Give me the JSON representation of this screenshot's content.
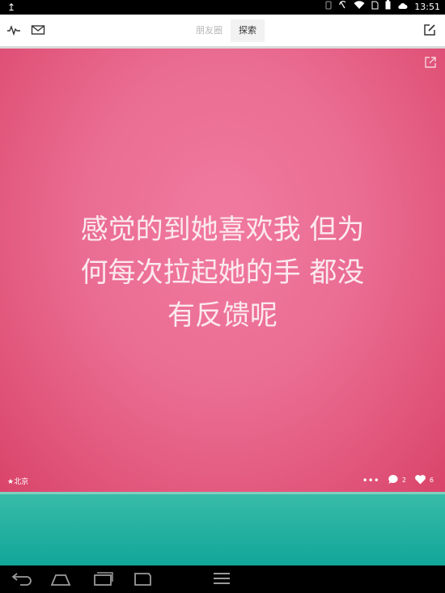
{
  "status_bar": {
    "time": "13:51"
  },
  "header": {
    "tabs": [
      {
        "label": "朋友圈",
        "active": false
      },
      {
        "label": "探索",
        "active": true
      }
    ]
  },
  "post": {
    "text_lines": [
      "感觉的到她喜欢我 但为",
      "何每次拉起她的手 都没",
      "有反馈呢"
    ],
    "location": "北京",
    "comment_count": "2",
    "like_count": "6",
    "background_colors": [
      "#f17aa0",
      "#d9446a"
    ]
  },
  "teal_color": "#13a89b"
}
